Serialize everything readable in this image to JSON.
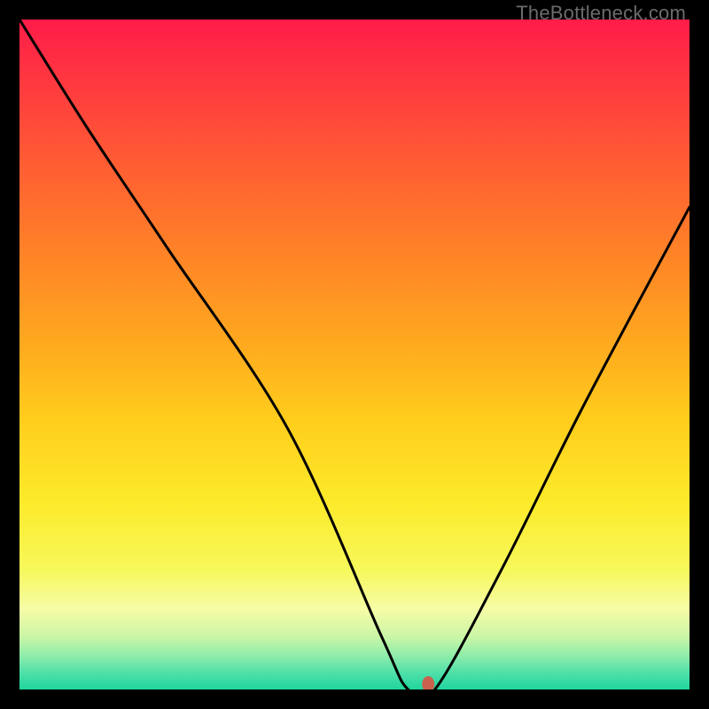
{
  "watermark": "TheBottleneck.com",
  "chart_data": {
    "type": "line",
    "title": "",
    "xlabel": "",
    "ylabel": "",
    "xlim": [
      0,
      100
    ],
    "ylim": [
      0,
      100
    ],
    "series": [
      {
        "name": "bottleneck-curve",
        "x": [
          0,
          10,
          22,
          40,
          54,
          58,
          62,
          72,
          84,
          100
        ],
        "y": [
          100,
          84,
          66,
          39,
          8,
          0,
          0,
          18,
          42,
          72
        ]
      }
    ],
    "marker": {
      "x": 61,
      "y": 0.8
    },
    "background": {
      "type": "vertical-gradient",
      "stops": [
        {
          "offset": 0.0,
          "color": "#ff1c49"
        },
        {
          "offset": 0.1,
          "color": "#ff3a3f"
        },
        {
          "offset": 0.22,
          "color": "#ff5e33"
        },
        {
          "offset": 0.35,
          "color": "#ff8327"
        },
        {
          "offset": 0.48,
          "color": "#ffa81f"
        },
        {
          "offset": 0.6,
          "color": "#ffce1c"
        },
        {
          "offset": 0.72,
          "color": "#fcea2a"
        },
        {
          "offset": 0.82,
          "color": "#f7f85a"
        },
        {
          "offset": 0.88,
          "color": "#f6fca6"
        },
        {
          "offset": 0.92,
          "color": "#ccf6a6"
        },
        {
          "offset": 0.95,
          "color": "#8eecaa"
        },
        {
          "offset": 0.975,
          "color": "#4fe0a9"
        },
        {
          "offset": 1.0,
          "color": "#1fd59e"
        }
      ]
    }
  }
}
